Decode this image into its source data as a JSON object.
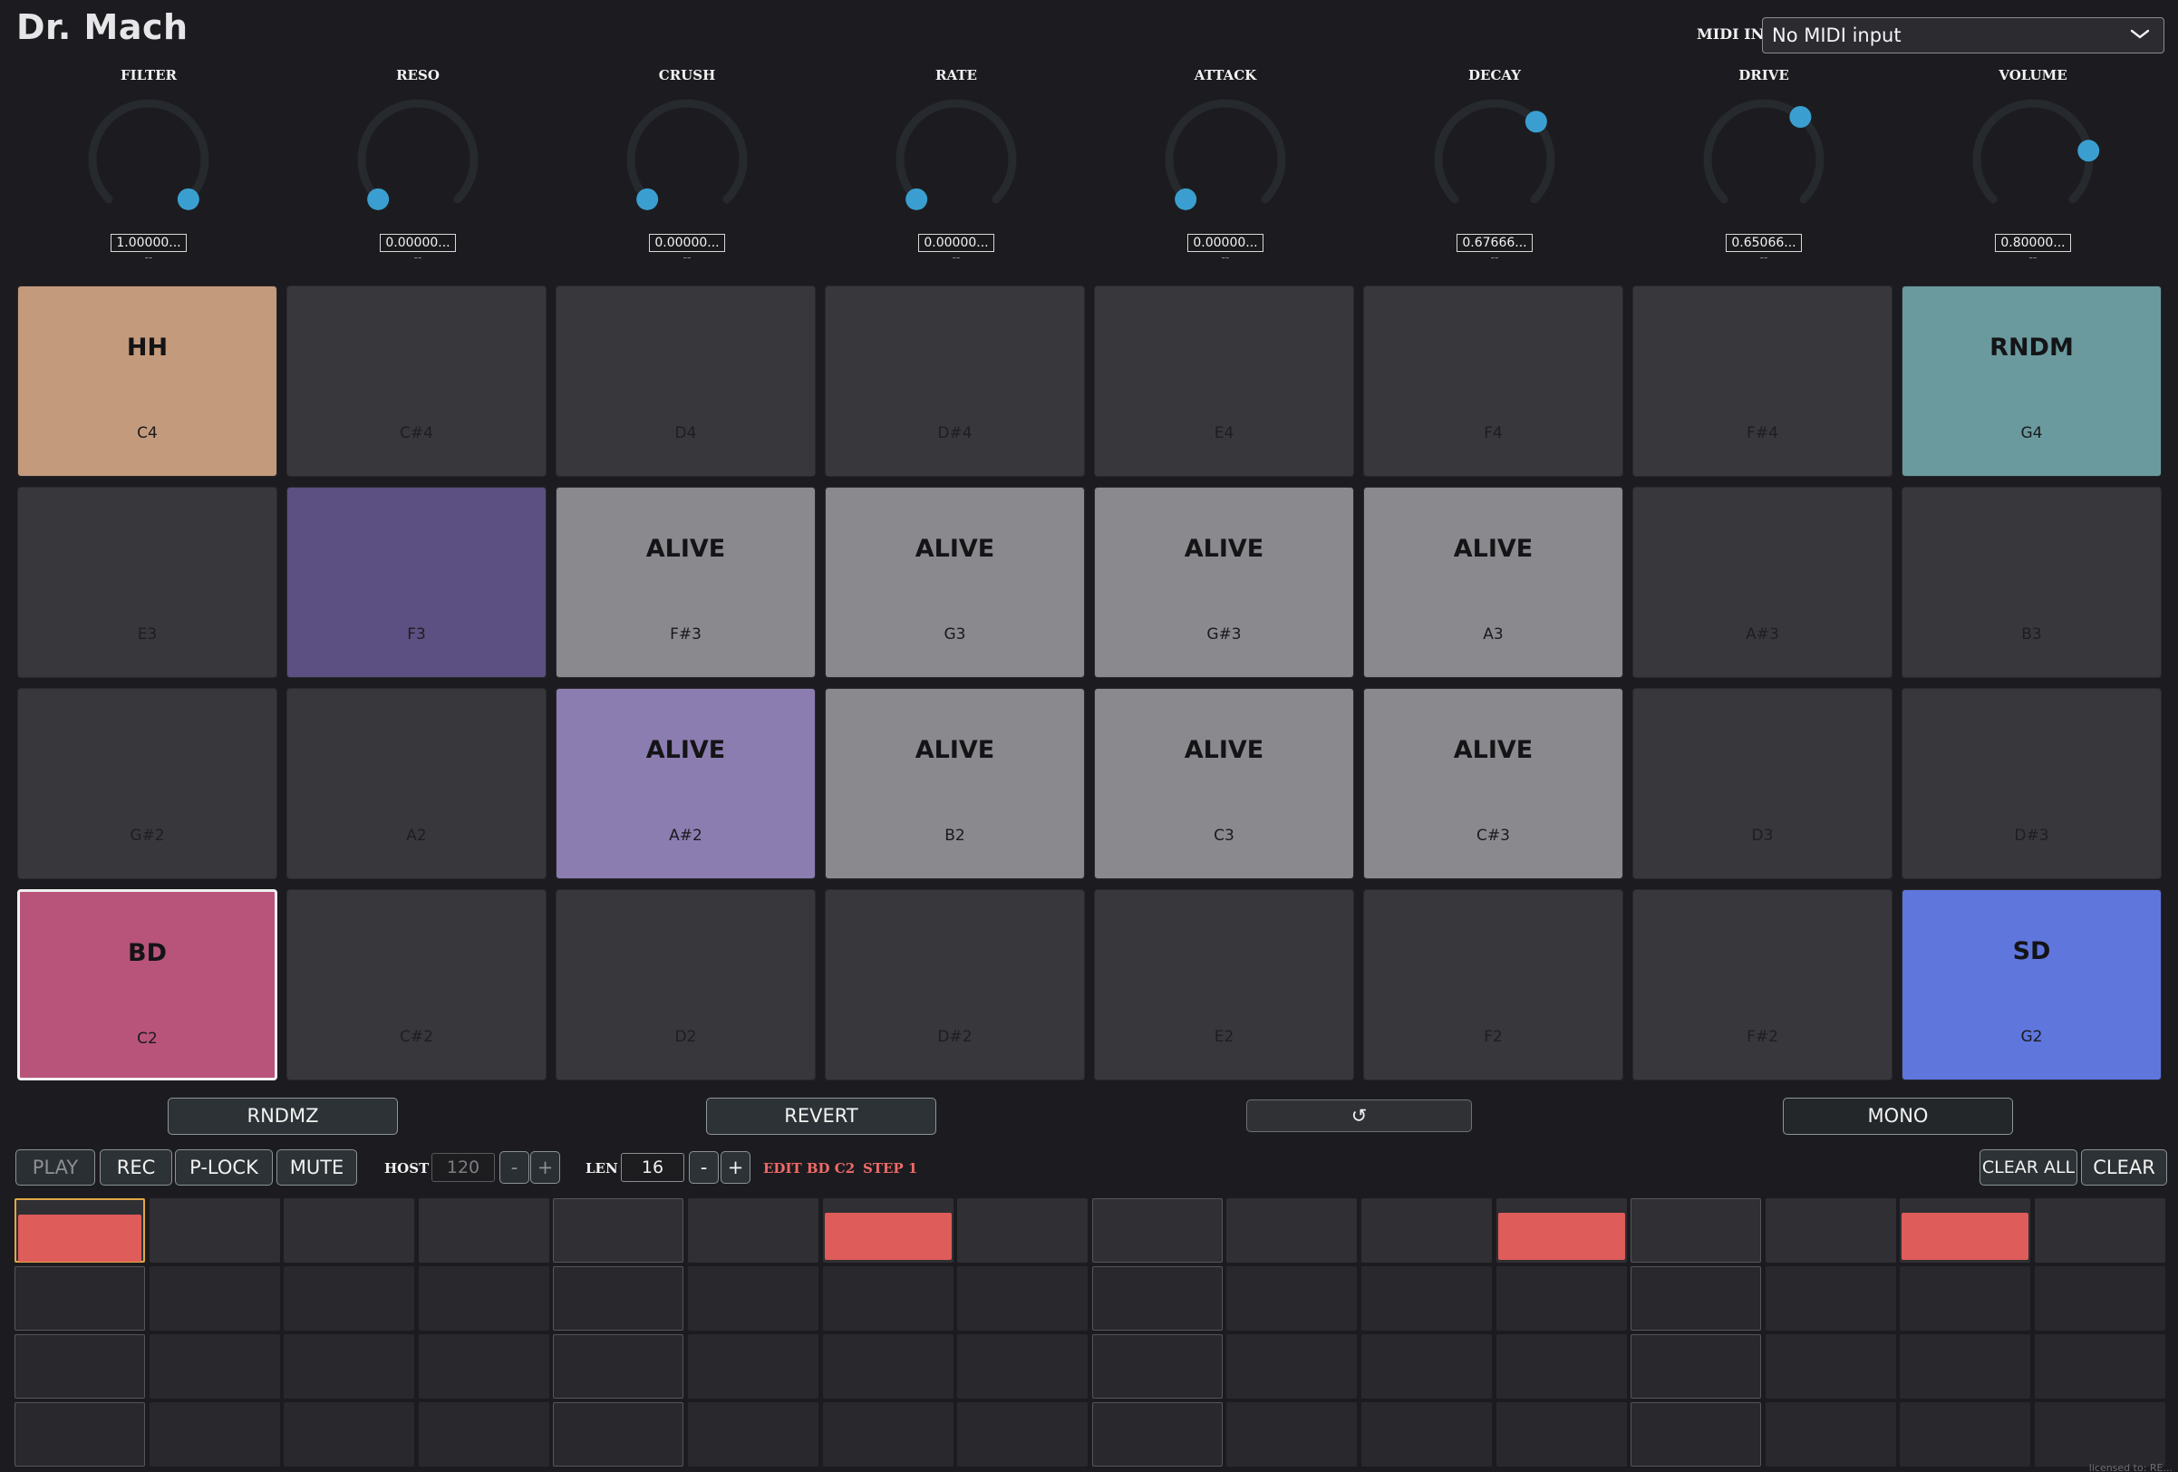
{
  "app": {
    "title": "Dr. Mach"
  },
  "midi": {
    "label": "MIDI IN",
    "selected": "No MIDI input"
  },
  "knobs": [
    {
      "label": "FILTER",
      "value": "1.00000...",
      "sub": "--",
      "position": 1.0,
      "dot_color": "#3a9fd0"
    },
    {
      "label": "RESO",
      "value": "0.00000...",
      "sub": "--",
      "position": 0.0,
      "dot_color": "#3a9fd0"
    },
    {
      "label": "CRUSH",
      "value": "0.00000...",
      "sub": "--",
      "position": 0.0,
      "dot_color": "#3a9fd0"
    },
    {
      "label": "RATE",
      "value": "0.00000...",
      "sub": "--",
      "position": 0.0,
      "dot_color": "#3a9fd0"
    },
    {
      "label": "ATTACK",
      "value": "0.00000...",
      "sub": "--",
      "position": 0.0,
      "dot_color": "#3a9fd0"
    },
    {
      "label": "DECAY",
      "value": "0.67666...",
      "sub": "--",
      "position": 0.67666,
      "dot_color": "#3a9fd0"
    },
    {
      "label": "DRIVE",
      "value": "0.65066...",
      "sub": "--",
      "position": 0.65066,
      "dot_color": "#3a9fd0"
    },
    {
      "label": "VOLUME",
      "value": "0.80000...",
      "sub": "--",
      "position": 0.8,
      "dot_color": "#3a9fd0"
    }
  ],
  "pads": [
    {
      "name": "HH",
      "note": "C4",
      "color": "#c49a7c"
    },
    {
      "name": "",
      "note": "C#4",
      "color": "#38373c"
    },
    {
      "name": "",
      "note": "D4",
      "color": "#38373c"
    },
    {
      "name": "",
      "note": "D#4",
      "color": "#38373c"
    },
    {
      "name": "",
      "note": "E4",
      "color": "#38373c"
    },
    {
      "name": "",
      "note": "F4",
      "color": "#38373c"
    },
    {
      "name": "",
      "note": "F#4",
      "color": "#38373c"
    },
    {
      "name": "RNDM",
      "note": "G4",
      "color": "#6a9a9e"
    },
    {
      "name": "",
      "note": "E3",
      "color": "#38373c"
    },
    {
      "name": "",
      "note": "F3",
      "color": "#5c4f82"
    },
    {
      "name": "ALIVE",
      "note": "F#3",
      "color": "#8a898e"
    },
    {
      "name": "ALIVE",
      "note": "G3",
      "color": "#8a898e"
    },
    {
      "name": "ALIVE",
      "note": "G#3",
      "color": "#8a898e"
    },
    {
      "name": "ALIVE",
      "note": "A3",
      "color": "#8a898e"
    },
    {
      "name": "",
      "note": "A#3",
      "color": "#38373c"
    },
    {
      "name": "",
      "note": "B3",
      "color": "#38373c"
    },
    {
      "name": "",
      "note": "G#2",
      "color": "#38373c"
    },
    {
      "name": "",
      "note": "A2",
      "color": "#38373c"
    },
    {
      "name": "ALIVE",
      "note": "A#2",
      "color": "#8c7db1"
    },
    {
      "name": "ALIVE",
      "note": "B2",
      "color": "#8a898e"
    },
    {
      "name": "ALIVE",
      "note": "C3",
      "color": "#8a898e"
    },
    {
      "name": "ALIVE",
      "note": "C#3",
      "color": "#8a898e"
    },
    {
      "name": "",
      "note": "D3",
      "color": "#38373c"
    },
    {
      "name": "",
      "note": "D#3",
      "color": "#38373c"
    },
    {
      "name": "BD",
      "note": "C2",
      "color": "#b8547a",
      "selected": true
    },
    {
      "name": "",
      "note": "C#2",
      "color": "#38373c"
    },
    {
      "name": "",
      "note": "D2",
      "color": "#38373c"
    },
    {
      "name": "",
      "note": "D#2",
      "color": "#38373c"
    },
    {
      "name": "",
      "note": "E2",
      "color": "#38373c"
    },
    {
      "name": "",
      "note": "F2",
      "color": "#38373c"
    },
    {
      "name": "",
      "note": "F#2",
      "color": "#38373c"
    },
    {
      "name": "SD",
      "note": "G2",
      "color": "#5f76dd"
    }
  ],
  "actions": {
    "randomize": "RNDMZ",
    "revert": "REVERT",
    "undo": "↺",
    "mono": "MONO"
  },
  "transport": {
    "play": "PLAY",
    "rec": "REC",
    "plock": "P-LOCK",
    "mute": "MUTE",
    "host_label": "HOST",
    "host_bpm": "120",
    "minus": "-",
    "plus": "+",
    "len_label": "LEN",
    "len_value": "16",
    "edit_info": "EDIT BD C2",
    "step_info": "STEP 1",
    "clear_all": "CLEAR ALL",
    "clear": "CLEAR"
  },
  "steps": {
    "rows": 4,
    "cols": 16,
    "active_row0": [
      0,
      6,
      11,
      14
    ],
    "current_step": 0,
    "active_color": "#de5c59"
  },
  "footer": {
    "note": "licensed to: RE..."
  }
}
